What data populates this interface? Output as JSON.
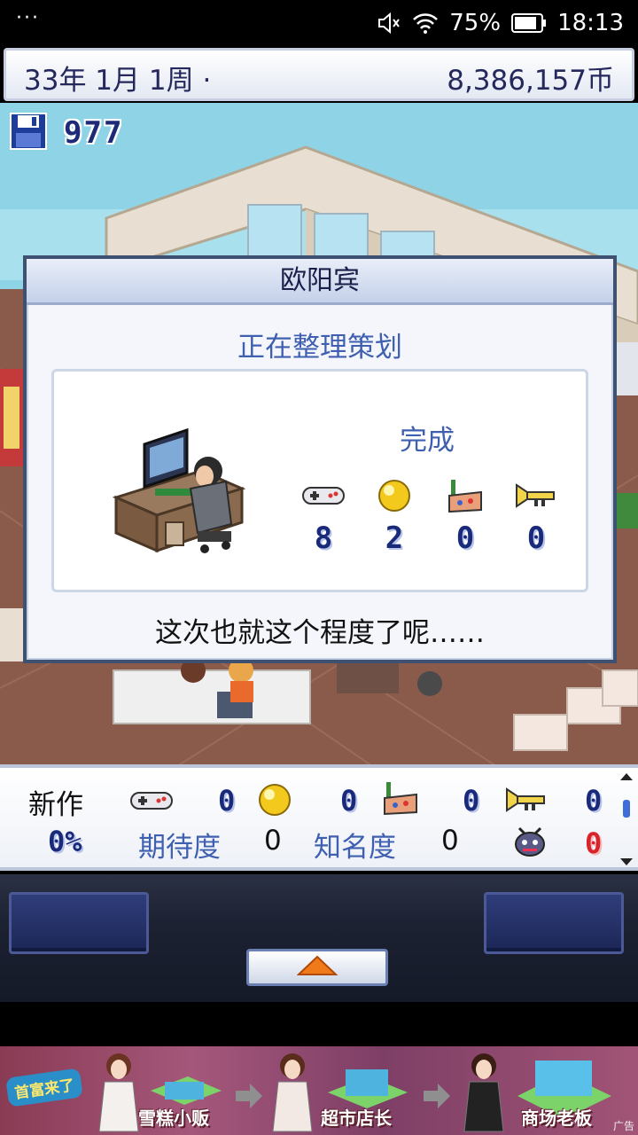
{
  "status_bar": {
    "dots": "···",
    "battery": "75%",
    "time": "18:13"
  },
  "top_bar": {
    "date": "33年 1月 1周 ·",
    "money": "8,386,157币"
  },
  "scene": {
    "save_count": "977"
  },
  "dialog": {
    "title": "欧阳宾",
    "status": "正在整理策划",
    "done_label": "完成",
    "stats": [
      {
        "icon": "gamepad-icon",
        "value": "8"
      },
      {
        "icon": "gold-orb-icon",
        "value": "2"
      },
      {
        "icon": "paint-palette-icon",
        "value": "0"
      },
      {
        "icon": "trumpet-icon",
        "value": "0"
      }
    ],
    "comment": "这次也就这个程度了呢……"
  },
  "new_game_panel": {
    "label": "新作",
    "stat_values": [
      "0",
      "0",
      "0",
      "0"
    ],
    "progress": "0%",
    "expectation_label": "期待度",
    "expectation_value": "0",
    "fame_label": "知名度",
    "fame_value": "0",
    "bug_count": "0"
  },
  "ad_banner": {
    "logo_text": "首富来了",
    "steps": [
      "雪糕小贩",
      "超市店长",
      "商场老板"
    ],
    "ad_tag": "广告"
  },
  "colors": {
    "accent_blue": "#3f5fb0",
    "pixel_blue": "#1a2a7a",
    "bug_red": "#d8232a"
  }
}
